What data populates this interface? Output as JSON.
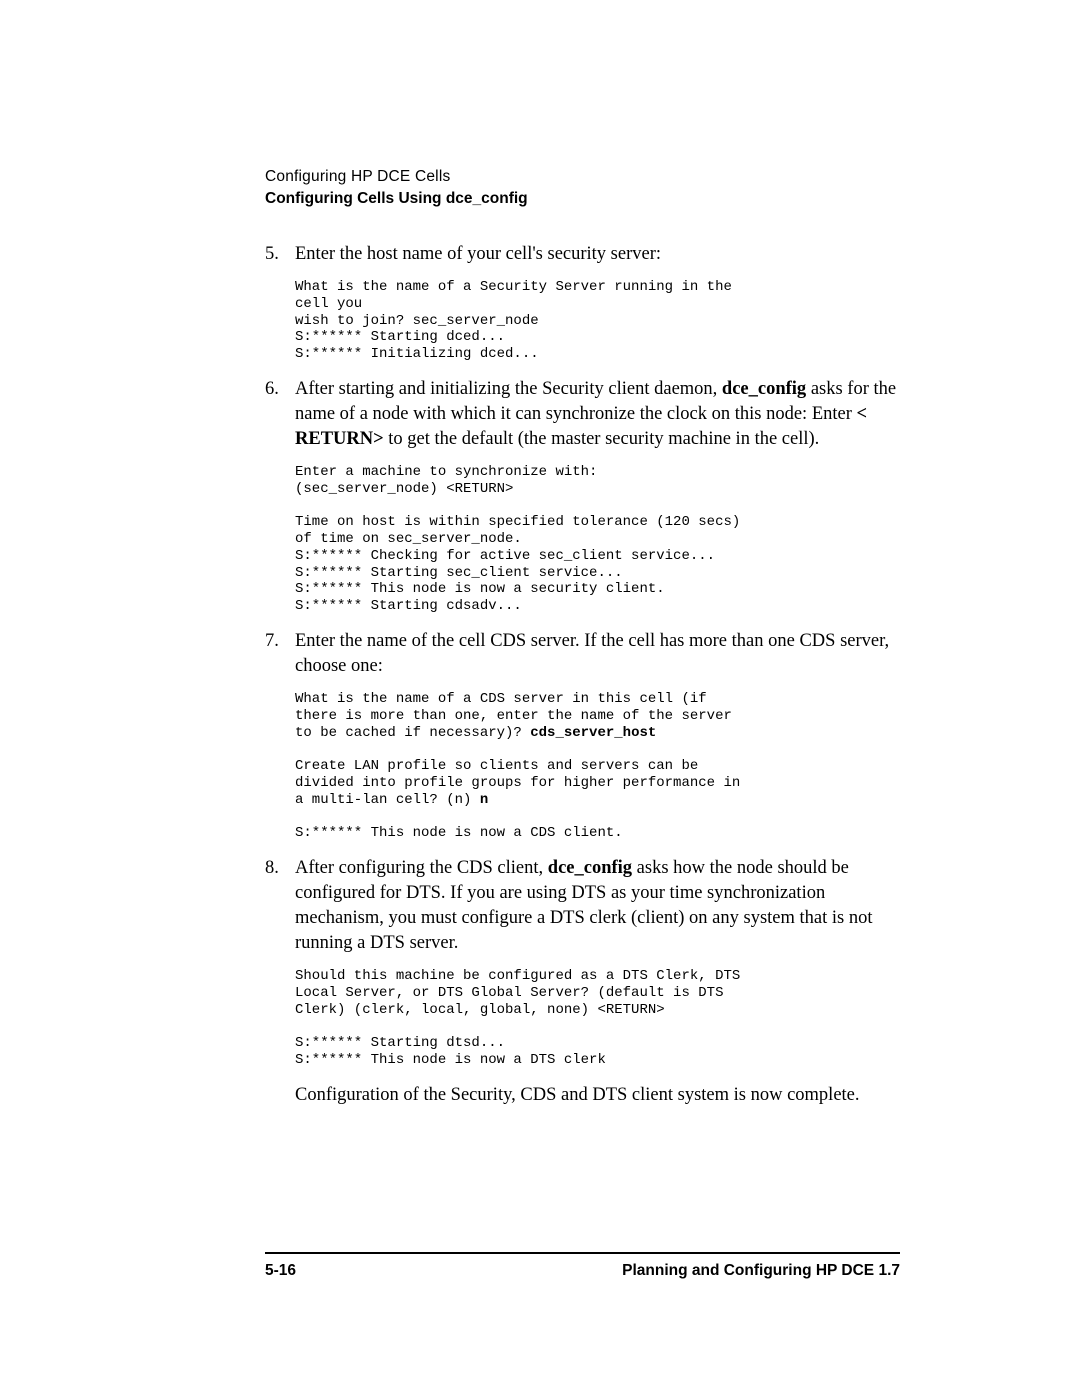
{
  "header": {
    "chapter": "Configuring HP DCE Cells",
    "section": "Configuring Cells Using dce_config"
  },
  "steps": [
    {
      "num": "5.",
      "para_parts": [
        "Enter the host name of your cell's security server:"
      ],
      "code": "What is the name of a Security Server running in the\ncell you\nwish to join? sec_server_node\nS:****** Starting dced...\nS:****** Initializing dced..."
    },
    {
      "num": "6.",
      "para_parts": [
        "After starting and initializing the Security client daemon, ",
        {
          "b": "dce_config"
        },
        " asks for the name of a node with which it can synchronize the clock on this node: Enter ",
        {
          "b": "< RETURN>"
        },
        " to get the default (the master security machine in the cell)."
      ],
      "code": "Enter a machine to synchronize with:\n(sec_server_node) <RETURN>\n\nTime on host is within specified tolerance (120 secs)\nof time on sec_server_node.\nS:****** Checking for active sec_client service...\nS:****** Starting sec_client service...\nS:****** This node is now a security client.\nS:****** Starting cdsadv..."
    },
    {
      "num": "7.",
      "para_parts": [
        "Enter the name of the cell CDS server. If the cell has more than one CDS server, choose one:"
      ],
      "code_parts": [
        "What is the name of a CDS server in this cell (if\nthere is more than one, enter the name of the server\nto be cached if necessary)? ",
        {
          "b": "cds_server_host"
        },
        "\n\nCreate LAN profile so clients and servers can be\ndivided into profile groups for higher performance in\na multi-lan cell? (n) ",
        {
          "b": "n"
        },
        "\n\nS:****** This node is now a CDS client."
      ]
    },
    {
      "num": "8.",
      "para_parts": [
        "After configuring the CDS client, ",
        {
          "b": "dce_config"
        },
        " asks how the node should be configured for DTS. If you are using DTS as your time synchronization mechanism, you must configure a DTS clerk (client) on any system that is not running a DTS server."
      ],
      "code": "Should this machine be configured as a DTS Clerk, DTS\nLocal Server, or DTS Global Server? (default is DTS\nClerk) (clerk, local, global, none) <RETURN>\n\nS:****** Starting dtsd...\nS:****** This node is now a DTS clerk",
      "after": "Configuration of the Security, CDS and DTS client system is now complete."
    }
  ],
  "footer": {
    "left": "5-16",
    "right": "Planning and Configuring HP DCE 1.7"
  }
}
